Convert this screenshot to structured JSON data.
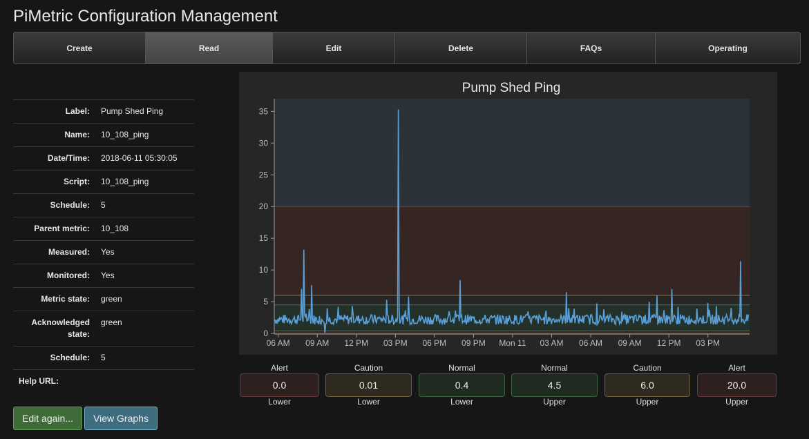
{
  "app": {
    "title": "PiMetric Configuration Management"
  },
  "nav": {
    "items": [
      {
        "label": "Create",
        "active": false
      },
      {
        "label": "Read",
        "active": true
      },
      {
        "label": "Edit",
        "active": false
      },
      {
        "label": "Delete",
        "active": false
      },
      {
        "label": "FAQs",
        "active": false
      },
      {
        "label": "Operating",
        "active": false
      }
    ]
  },
  "details": [
    {
      "label": "Label:",
      "value": "Pump Shed Ping"
    },
    {
      "label": "Name:",
      "value": "10_108_ping"
    },
    {
      "label": "Date/Time:",
      "value": "2018-06-11 05:30:05"
    },
    {
      "label": "Script:",
      "value": "10_108_ping"
    },
    {
      "label": "Schedule:",
      "value": "5"
    },
    {
      "label": "Parent metric:",
      "value": "10_108"
    },
    {
      "label": "Measured:",
      "value": "Yes"
    },
    {
      "label": "Monitored:",
      "value": "Yes"
    },
    {
      "label": "Metric state:",
      "value": "green"
    },
    {
      "label": "Acknowledged state:",
      "value": "green"
    },
    {
      "label": "Schedule:",
      "value": "5"
    }
  ],
  "help": {
    "label": "Help URL:"
  },
  "buttons": {
    "edit_again": "Edit again...",
    "view_graphs": "View Graphs"
  },
  "chart_data": {
    "type": "line",
    "title": "Pump Shed Ping",
    "xlabel": "",
    "ylabel": "",
    "ylim": [
      0,
      37
    ],
    "yticks": [
      0,
      5,
      10,
      15,
      20,
      25,
      30,
      35
    ],
    "xlim_hours": [
      -0.3,
      25.5
    ],
    "xticks": [
      {
        "hour": 0,
        "label": "06 AM"
      },
      {
        "hour": 3,
        "label": "09 AM"
      },
      {
        "hour": 6,
        "label": "12 PM"
      },
      {
        "hour": 9,
        "label": "03 PM"
      },
      {
        "hour": 12,
        "label": "06 PM"
      },
      {
        "hour": 15,
        "label": "09 PM"
      },
      {
        "hour": 18,
        "label": "Mon 11"
      },
      {
        "hour": 21,
        "label": "03 AM"
      },
      {
        "hour": 24,
        "label": "06 AM"
      },
      {
        "hour": 27,
        "label": "09 AM"
      },
      {
        "hour": 30,
        "label": "12 PM"
      },
      {
        "hour": 33,
        "label": "03 PM"
      }
    ],
    "bands": [
      {
        "name": "alert",
        "from": 20,
        "to": 37,
        "color": "#2a3339"
      },
      {
        "name": "caution",
        "from": 6,
        "to": 20,
        "color": "#352624"
      },
      {
        "name": "normal",
        "from": 0.4,
        "to": 4.5,
        "color": "#24312a"
      }
    ],
    "lines": [
      {
        "value": 20,
        "color": "#8a3a3a"
      },
      {
        "value": 6,
        "color": "#8a7a3a"
      },
      {
        "value": 4.5,
        "color": "#3e7a42"
      },
      {
        "value": 0.4,
        "color": "#3e7a42"
      },
      {
        "value": 0.01,
        "color": "#8a7a3a"
      },
      {
        "value": 0.0,
        "color": "#8a3a3a"
      }
    ],
    "series": [
      {
        "color": "#5aa0d8",
        "spikes": [
          {
            "hour": 1.8,
            "value": 7.0
          },
          {
            "hour": 2.0,
            "value": 13.2
          },
          {
            "hour": 2.6,
            "value": 7.6
          },
          {
            "hour": 3.6,
            "value": 0.1
          },
          {
            "hour": 4.6,
            "value": 4.2
          },
          {
            "hour": 8.3,
            "value": 5.3
          },
          {
            "hour": 9.2,
            "value": 35.3
          },
          {
            "hour": 10.0,
            "value": 5.8
          },
          {
            "hour": 14.0,
            "value": 8.4
          },
          {
            "hour": 22.1,
            "value": 6.5
          },
          {
            "hour": 28.5,
            "value": 5.0
          },
          {
            "hour": 29.1,
            "value": 6.0
          },
          {
            "hour": 30.2,
            "value": 7.0
          },
          {
            "hour": 33.0,
            "value": 4.8
          },
          {
            "hour": 35.5,
            "value": 11.4
          }
        ]
      }
    ]
  },
  "thresholds": [
    {
      "top": "Alert",
      "value": "0.0",
      "bottom": "Lower",
      "kind": "alert"
    },
    {
      "top": "Caution",
      "value": "0.01",
      "bottom": "Lower",
      "kind": "caution"
    },
    {
      "top": "Normal",
      "value": "0.4",
      "bottom": "Lower",
      "kind": "normal"
    },
    {
      "top": "Normal",
      "value": "4.5",
      "bottom": "Upper",
      "kind": "normal"
    },
    {
      "top": "Caution",
      "value": "6.0",
      "bottom": "Upper",
      "kind": "caution"
    },
    {
      "top": "Alert",
      "value": "20.0",
      "bottom": "Upper",
      "kind": "alert"
    }
  ]
}
